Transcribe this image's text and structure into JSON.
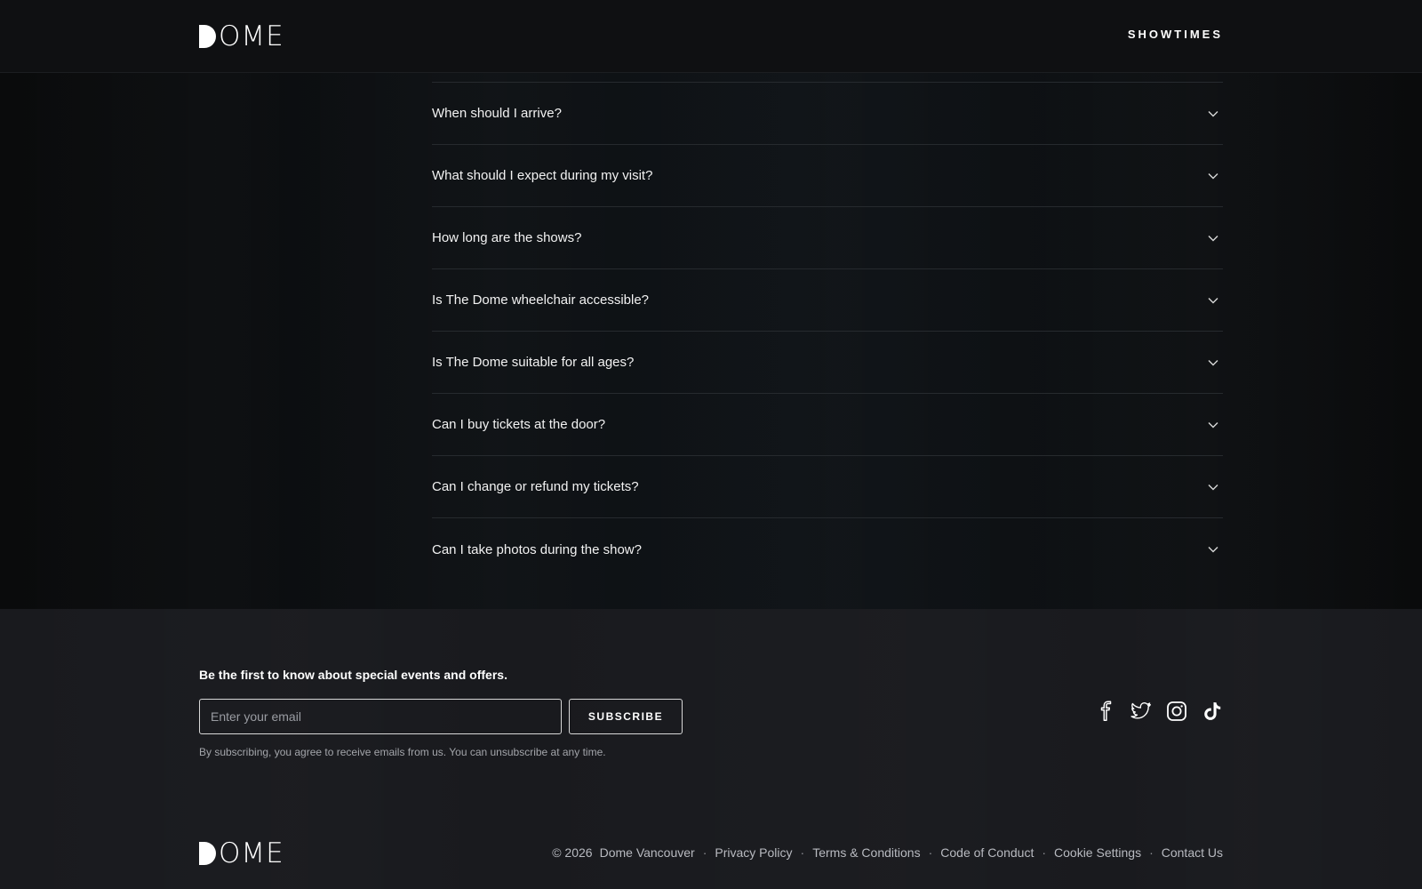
{
  "header": {
    "logo_text": "DOME",
    "nav_showtimes": "SHOWTIMES"
  },
  "faq": {
    "items": [
      {
        "question": "When should I arrive?",
        "icon": "chevron-down-icon"
      },
      {
        "question": "What should I expect during my visit?",
        "icon": "chevron-down-icon"
      },
      {
        "question": "How long are the shows?",
        "icon": "chevron-down-icon"
      },
      {
        "question": "Is The Dome wheelchair accessible?",
        "icon": "chevron-down-icon"
      },
      {
        "question": "Is The Dome suitable for all ages?",
        "icon": "chevron-down-icon"
      },
      {
        "question": "Can I buy tickets at the door?",
        "icon": "chevron-down-icon"
      },
      {
        "question": "Can I change or refund my tickets?",
        "icon": "chevron-down-icon"
      },
      {
        "question": "Can I take photos during the show?",
        "icon": "chevron-down-icon"
      }
    ]
  },
  "newsletter": {
    "heading": "Be the first to know about special events and offers.",
    "email_placeholder": "Enter your email",
    "email_value": "",
    "subscribe_label": "SUBSCRIBE",
    "disclaimer": "By subscribing, you agree to receive emails from us. You can unsubscribe at any time."
  },
  "social": {
    "icons": [
      "facebook-icon",
      "twitter-icon",
      "instagram-icon",
      "tiktok-icon"
    ]
  },
  "footer": {
    "logo_text": "DOME",
    "copyright": "© 2026",
    "brand": "Dome Vancouver",
    "separator": "·",
    "links": {
      "privacy": "Privacy Policy",
      "terms": "Terms & Conditions",
      "conduct": "Code of Conduct",
      "cookies": "Cookie Settings",
      "contact": "Contact Us"
    }
  },
  "colors": {
    "background": "#0b0c0e",
    "footer_background": "#191a1e",
    "divider": "#262a2e",
    "text": "#ffffff",
    "muted_text": "#b8bac0"
  }
}
